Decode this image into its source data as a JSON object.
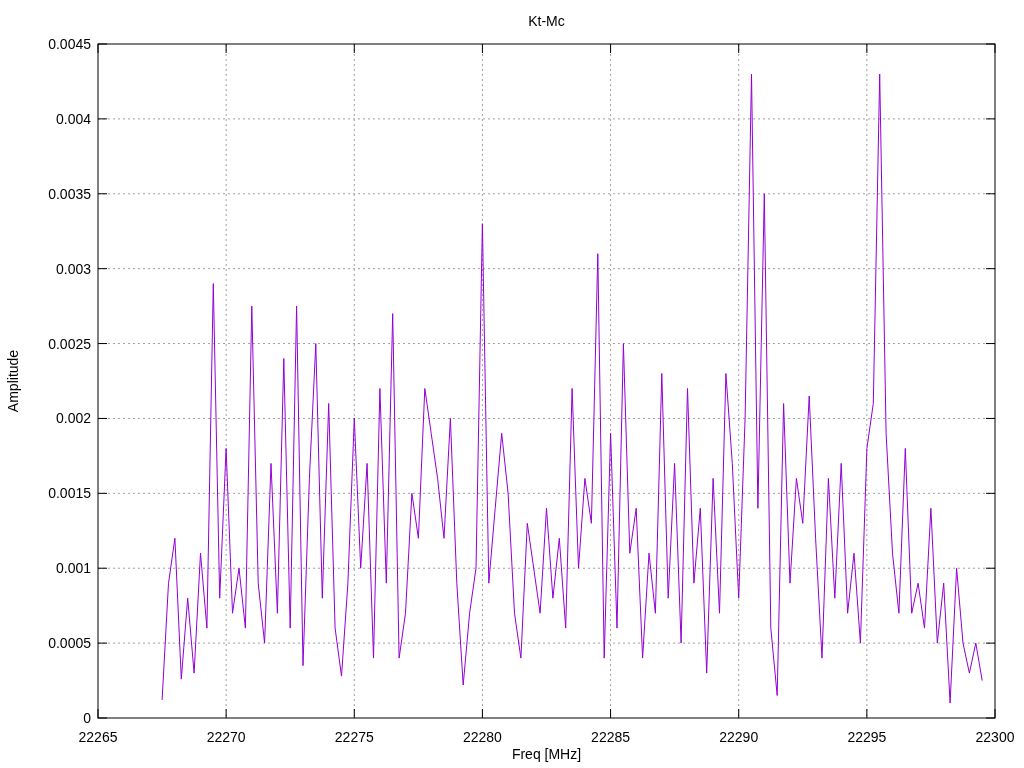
{
  "chart_data": {
    "type": "line",
    "title": "Kt-Mc",
    "xlabel": "Freq [MHz]",
    "ylabel": "Amplitude",
    "xlim": [
      22265,
      22300
    ],
    "ylim": [
      0,
      0.0045
    ],
    "grid": true,
    "xticks": [
      22265,
      22270,
      22275,
      22280,
      22285,
      22290,
      22295,
      22300
    ],
    "yticks": [
      0,
      0.0005,
      0.001,
      0.0015,
      0.002,
      0.0025,
      0.003,
      0.0035,
      0.004,
      0.0045
    ],
    "x": [
      22267.5,
      22267.75,
      22268,
      22268.25,
      22268.5,
      22268.75,
      22269,
      22269.25,
      22269.5,
      22269.75,
      22270,
      22270.25,
      22270.5,
      22270.75,
      22271,
      22271.25,
      22271.5,
      22271.75,
      22272,
      22272.25,
      22272.5,
      22272.75,
      22273,
      22273.25,
      22273.5,
      22273.75,
      22274,
      22274.25,
      22274.5,
      22274.75,
      22275,
      22275.25,
      22275.5,
      22275.75,
      22276,
      22276.25,
      22276.5,
      22276.75,
      22277,
      22277.25,
      22277.5,
      22277.75,
      22278,
      22278.25,
      22278.5,
      22278.75,
      22279,
      22279.25,
      22279.5,
      22279.75,
      22280,
      22280.25,
      22280.5,
      22280.75,
      22281,
      22281.25,
      22281.5,
      22281.75,
      22282,
      22282.25,
      22282.5,
      22282.75,
      22283,
      22283.25,
      22283.5,
      22283.75,
      22284,
      22284.25,
      22284.5,
      22284.75,
      22285,
      22285.25,
      22285.5,
      22285.75,
      22286,
      22286.25,
      22286.5,
      22286.75,
      22287,
      22287.25,
      22287.5,
      22287.75,
      22288,
      22288.25,
      22288.5,
      22288.75,
      22289,
      22289.25,
      22289.5,
      22289.75,
      22290,
      22290.25,
      22290.5,
      22290.75,
      22291,
      22291.25,
      22291.5,
      22291.75,
      22292,
      22292.25,
      22292.5,
      22292.75,
      22293,
      22293.25,
      22293.5,
      22293.75,
      22294,
      22294.25,
      22294.5,
      22294.75,
      22295,
      22295.25,
      22295.5,
      22295.75,
      22296,
      22296.25,
      22296.5,
      22296.75,
      22297,
      22297.25,
      22297.5,
      22297.75,
      22298,
      22298.25,
      22298.5,
      22298.75,
      22299,
      22299.25,
      22299.5
    ],
    "series": [
      {
        "color": "#9400d3",
        "values": [
          0.00012,
          0.0009,
          0.0012,
          0.00026,
          0.0008,
          0.0003,
          0.0011,
          0.0006,
          0.0029,
          0.0008,
          0.0018,
          0.0007,
          0.001,
          0.0006,
          0.00275,
          0.0009,
          0.0005,
          0.0017,
          0.0007,
          0.0024,
          0.0006,
          0.00275,
          0.00035,
          0.0016,
          0.0025,
          0.0008,
          0.0021,
          0.0006,
          0.00028,
          0.0009,
          0.002,
          0.001,
          0.0017,
          0.0004,
          0.0022,
          0.0009,
          0.0027,
          0.0004,
          0.0007,
          0.0015,
          0.0012,
          0.0022,
          0.0019,
          0.0016,
          0.0012,
          0.002,
          0.0009,
          0.00022,
          0.0007,
          0.001,
          0.0033,
          0.0009,
          0.0014,
          0.0019,
          0.0015,
          0.0007,
          0.0004,
          0.0013,
          0.001,
          0.0007,
          0.0014,
          0.0008,
          0.0012,
          0.0006,
          0.0022,
          0.001,
          0.0016,
          0.0013,
          0.0031,
          0.0004,
          0.0019,
          0.0006,
          0.0025,
          0.0011,
          0.0014,
          0.0004,
          0.0011,
          0.0007,
          0.0023,
          0.0008,
          0.0017,
          0.0005,
          0.0022,
          0.0009,
          0.0014,
          0.0003,
          0.0016,
          0.0007,
          0.0023,
          0.0017,
          0.0008,
          0.002,
          0.0043,
          0.0014,
          0.0035,
          0.0006,
          0.00015,
          0.0021,
          0.0009,
          0.0016,
          0.0013,
          0.00215,
          0.0012,
          0.0004,
          0.0016,
          0.0008,
          0.0017,
          0.0007,
          0.0011,
          0.0005,
          0.0018,
          0.0021,
          0.0043,
          0.0019,
          0.0011,
          0.0007,
          0.0018,
          0.0007,
          0.0009,
          0.0006,
          0.0014,
          0.0005,
          0.0009,
          0.0001,
          0.001,
          0.0005,
          0.0003,
          0.0005,
          0.00025
        ]
      }
    ]
  }
}
